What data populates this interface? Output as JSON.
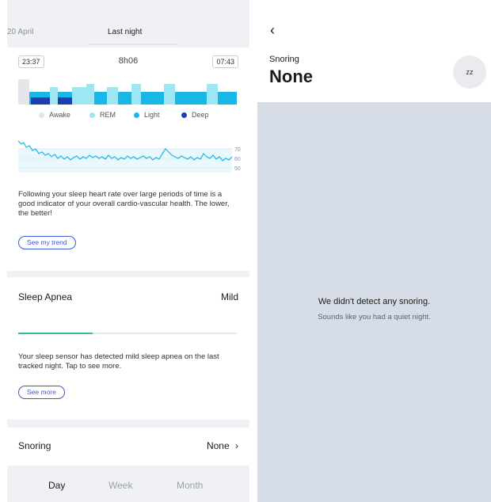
{
  "date_tabs": [
    {
      "label": "20 April",
      "active": false
    },
    {
      "label": "Last night",
      "active": true
    }
  ],
  "sleep": {
    "start_time": "23:37",
    "duration": "8h06",
    "end_time": "07:43",
    "legend": [
      {
        "label": "Awake",
        "color": "#e3e6ea"
      },
      {
        "label": "REM",
        "color": "#9ee6f2"
      },
      {
        "label": "Light",
        "color": "#19b7e6"
      },
      {
        "label": "Deep",
        "color": "#1b3fb0"
      }
    ]
  },
  "hr_chart": {
    "ticks": [
      "70",
      "60",
      "50"
    ],
    "description": "Following your sleep heart rate over large periods of time is a good indicator of your overall cardio-vascular health. The lower, the better!",
    "trend_button": "See my trend"
  },
  "apnea": {
    "title": "Sleep Apnea",
    "value": "Mild",
    "level_fraction": 0.34,
    "description": "Your sleep sensor has detected mild sleep apnea on the last tracked night. Tap to see more.",
    "more_button": "See more"
  },
  "snoring_row": {
    "title": "Snoring",
    "value": "None",
    "chevron": "›"
  },
  "bottom_tabs": [
    {
      "label": "Day",
      "active": true
    },
    {
      "label": "Week",
      "active": false
    },
    {
      "label": "Month",
      "active": false
    }
  ],
  "detail": {
    "back": "‹",
    "label": "Snoring",
    "value": "None",
    "zz_icon": "zz",
    "empty_title": "We didn't detect any snoring.",
    "empty_subtitle": "Sounds like you had a quiet night."
  },
  "colors": {
    "accent": "#3b5bd6",
    "apnea_fill": "#3cc08a",
    "hr_line": "#19b7e6",
    "empty_bg": "#d6dde6"
  }
}
